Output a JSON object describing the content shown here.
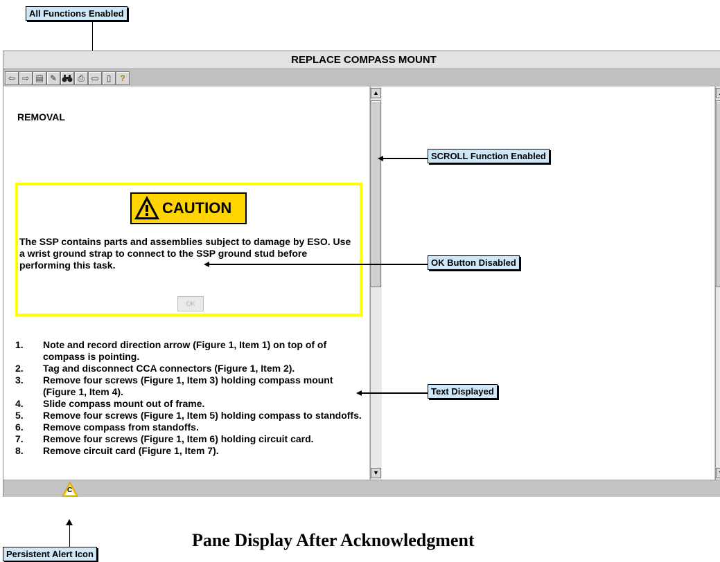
{
  "callouts": {
    "all_functions": "All Functions Enabled",
    "scroll": "SCROLL Function Enabled",
    "ok_disabled": "OK Button Disabled",
    "text_displayed": "Text Displayed",
    "persistent_alert": "Persistent Alert Icon"
  },
  "window": {
    "title": "REPLACE COMPASS MOUNT"
  },
  "toolbar": {
    "icons": [
      "back-arrow-icon",
      "forward-arrow-icon",
      "save-icon",
      "edit-icon",
      "find-binoculars-icon",
      "print-icon",
      "note-icon",
      "bookmark-icon",
      "help-icon"
    ],
    "glyphs": [
      "⇦",
      "⇨",
      "▤",
      "✎",
      "⚲",
      "⎙",
      "▭",
      "▯",
      "?"
    ]
  },
  "content": {
    "heading": "REMOVAL",
    "caution_label": "CAUTION",
    "caution_text": "The SSP contains parts and assemblies subject to damage by ESO. Use a wrist ground strap to connect to the SSP ground stud before performing this task.",
    "ok_label": "OK",
    "steps": [
      {
        "num": "1.",
        "text": "Note and record direction arrow (Figure 1, Item 1) on top of of compass is pointing."
      },
      {
        "num": "2.",
        "text": "Tag and disconnect CCA connectors (Figure 1, Item 2)."
      },
      {
        "num": "3.",
        "text": "Remove four screws (Figure 1, Item 3) holding compass mount (Figure 1, Item 4)."
      },
      {
        "num": "4.",
        "text": "Slide compass mount out of frame."
      },
      {
        "num": "5.",
        "text": "Remove four screws (Figure 1, Item 5) holding compass to standoffs."
      },
      {
        "num": "6.",
        "text": "Remove compass from standoffs."
      },
      {
        "num": "7.",
        "text": "Remove four screws (Figure 1, Item 6)  holding circuit card."
      },
      {
        "num": "8.",
        "text": "Remove circuit card (Figure 1, Item 7)."
      }
    ]
  },
  "status": {
    "alert_icon_letter": "C"
  },
  "caption": "Pane Display After Acknowledgment",
  "colors": {
    "callout_bg": "#cfe6f7",
    "caution_border": "#ffff00",
    "caution_sign": "#ffd400",
    "alert_icon": "#ffd400"
  }
}
